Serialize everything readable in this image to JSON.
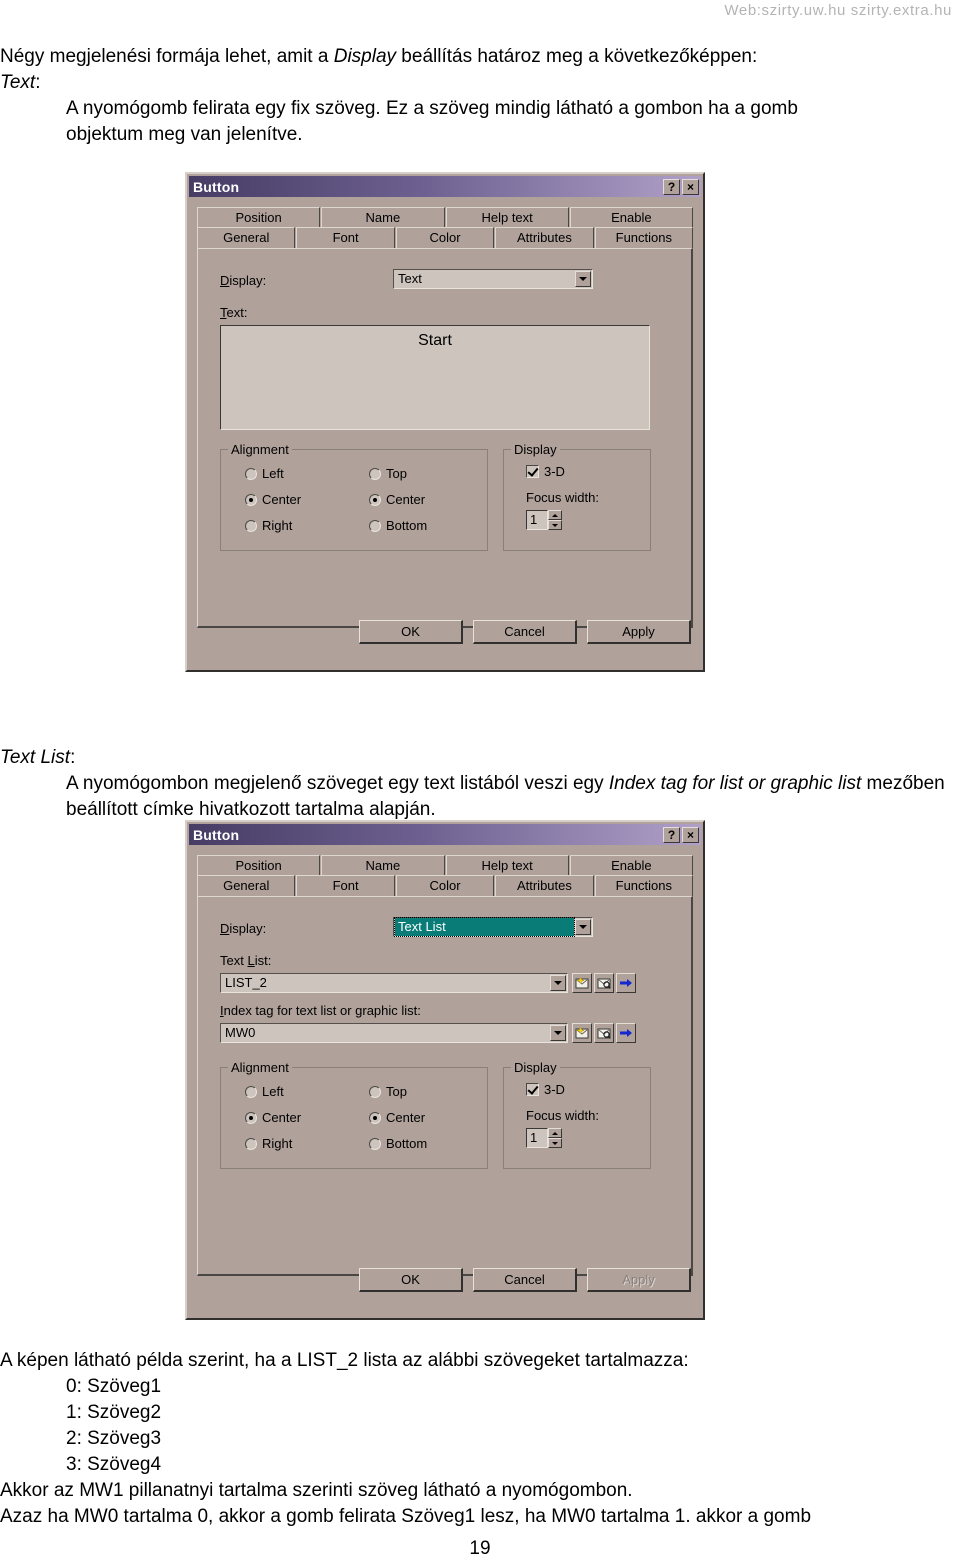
{
  "page": {
    "watermark": "Web:szirty.uw.hu  szirty.extra.hu",
    "page_number": "19"
  },
  "prose": {
    "intro_line1_a": "Négy megjelenési formája lehet, amit a ",
    "intro_line1_italic": "Display",
    "intro_line1_b": " beállítás határoz meg a következőképpen:",
    "heading_text": "Text",
    "heading_text_colon": ":",
    "text_body_line1": "A nyomógomb felirata egy fix szöveg. Ez a szöveg mindig látható a gombon ha a gomb",
    "text_body_line2": "objektum meg van jelenítve.",
    "heading_textlist": "Text List",
    "heading_textlist_colon": ":",
    "textlist_body_a": "A nyomógombon megjelenő szöveget egy text listából veszi egy ",
    "textlist_body_italic": "Index tag for list or graphic list",
    "textlist_body_b": " mezőben beállított címke hivatkozott tartalma alapján.",
    "bottom_line1": "A képen látható példa szerint, ha a LIST_2 lista az alábbi szövegeket tartalmazza:",
    "bottom_list": [
      "0: Szöveg1",
      "1: Szöveg2",
      "2: Szöveg3",
      "3: Szöveg4"
    ],
    "bottom_line2": "Akkor az MW1 pillanatnyi tartalma szerinti szöveg látható a nyomógombon.",
    "bottom_line3": "Azaz ha MW0 tartalma 0, akkor a gomb felirata Szöveg1 lesz, ha MW0 tartalma 1. akkor a gomb"
  },
  "dialog_text": {
    "title": "Button",
    "help_button": "?",
    "close_button": "×",
    "tabs_row1": [
      "Position",
      "Name",
      "Help text",
      "Enable"
    ],
    "tabs_row2": [
      "General",
      "Font",
      "Color",
      "Attributes",
      "Functions"
    ],
    "active_tab": "General",
    "display_label": "Display:",
    "display_value": "Text",
    "text_label": "Text:",
    "text_preview": "Start",
    "alignment_legend": "Alignment",
    "align_h": [
      {
        "label": "Left",
        "selected": false
      },
      {
        "label": "Center",
        "selected": true
      },
      {
        "label": "Right",
        "selected": false
      }
    ],
    "align_v": [
      {
        "label": "Top",
        "selected": false
      },
      {
        "label": "Center",
        "selected": true
      },
      {
        "label": "Bottom",
        "selected": false
      }
    ],
    "display_legend": "Display",
    "threed_label": "3-D",
    "threed_checked": true,
    "focus_width_label": "Focus width:",
    "focus_width_value": "1",
    "ok_label": "OK",
    "cancel_label": "Cancel",
    "apply_label": "Apply",
    "apply_disabled": false
  },
  "dialog_textlist": {
    "title": "Button",
    "help_button": "?",
    "close_button": "×",
    "tabs_row1": [
      "Position",
      "Name",
      "Help text",
      "Enable"
    ],
    "tabs_row2": [
      "General",
      "Font",
      "Color",
      "Attributes",
      "Functions"
    ],
    "active_tab": "General",
    "display_label": "Display:",
    "display_value": "Text List",
    "display_value_selected": true,
    "textlist_label": "Text List:",
    "textlist_value": "LIST_2",
    "index_tag_label": "Index tag for text list or graphic list:",
    "index_tag_value": "MW0",
    "alignment_legend": "Alignment",
    "align_h": [
      {
        "label": "Left",
        "selected": false
      },
      {
        "label": "Center",
        "selected": true
      },
      {
        "label": "Right",
        "selected": false
      }
    ],
    "align_v": [
      {
        "label": "Top",
        "selected": false
      },
      {
        "label": "Center",
        "selected": true
      },
      {
        "label": "Bottom",
        "selected": false
      }
    ],
    "display_legend": "Display",
    "threed_label": "3-D",
    "threed_checked": true,
    "focus_width_label": "Focus width:",
    "focus_width_value": "1",
    "ok_label": "OK",
    "cancel_label": "Cancel",
    "apply_label": "Apply",
    "apply_disabled": true
  },
  "icons": {
    "new_tag": "new-tag-icon",
    "browse_tag": "browse-tag-icon",
    "goto_tag": "goto-tag-icon"
  },
  "colors": {
    "dialog_face": "#b0a29b",
    "titlebar_start": "#463c64",
    "titlebar_end": "#b0a0c8",
    "selection": "#0a7c78",
    "watermark": "#b4b4b4"
  }
}
